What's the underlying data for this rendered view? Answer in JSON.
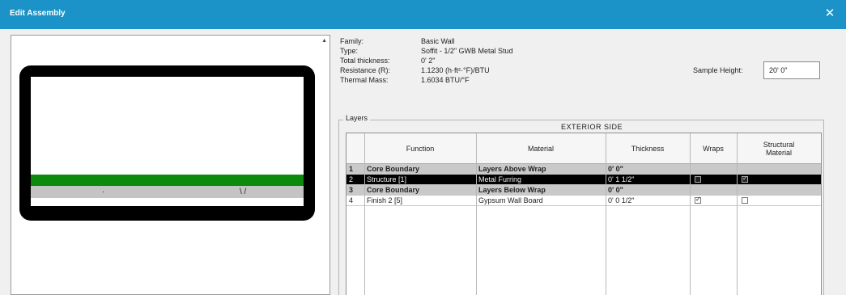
{
  "window": {
    "title": "Edit Assembly",
    "close_glyph": "✕"
  },
  "properties": [
    {
      "label": "Family:",
      "value": "Basic Wall"
    },
    {
      "label": "Type:",
      "value": "Soffit - 1/2\" GWB Metal Stud"
    },
    {
      "label": "Total thickness:",
      "value": "0' 2\""
    },
    {
      "label": "Resistance (R):",
      "value": "1.1230 (h·ft²·°F)/BTU"
    },
    {
      "label": "Thermal Mass:",
      "value": "1.6034 BTU/°F"
    }
  ],
  "sample_height": {
    "label": "Sample Height:",
    "value": "20' 0\""
  },
  "layers": {
    "caption": "Layers",
    "side_label": "EXTERIOR SIDE",
    "columns": [
      "Function",
      "Material",
      "Thickness",
      "Wraps",
      "Structural Material"
    ],
    "rows": [
      {
        "num": "1",
        "function": "Core Boundary",
        "material": "Layers Above Wrap",
        "thickness": "0' 0\"",
        "wraps": null,
        "structural": null,
        "style": "gray"
      },
      {
        "num": "2",
        "function": "Structure [1]",
        "material": "Metal Furring",
        "thickness": "0' 1 1/2\"",
        "wraps": false,
        "structural": true,
        "style": "selected"
      },
      {
        "num": "3",
        "function": "Core Boundary",
        "material": "Layers Below Wrap",
        "thickness": "0' 0\"",
        "wraps": null,
        "structural": null,
        "style": "gray"
      },
      {
        "num": "4",
        "function": "Finish 2 [5]",
        "material": "Gypsum Wall Board",
        "thickness": "0' 0 1/2\"",
        "wraps": true,
        "structural": false,
        "style": "normal"
      }
    ]
  },
  "preview": {
    "scroll_glyph": "▲",
    "glyph_left": "·",
    "glyph_right": "\\ /"
  },
  "colors": {
    "titlebar": "#1b93c8",
    "structure_layer": "#0b8a0b",
    "finish_layer": "#c4c4c4"
  },
  "icons": {
    "close": "close-icon",
    "scroll_up": "scroll-up-arrow-icon",
    "checkbox": "checkbox-icon"
  }
}
